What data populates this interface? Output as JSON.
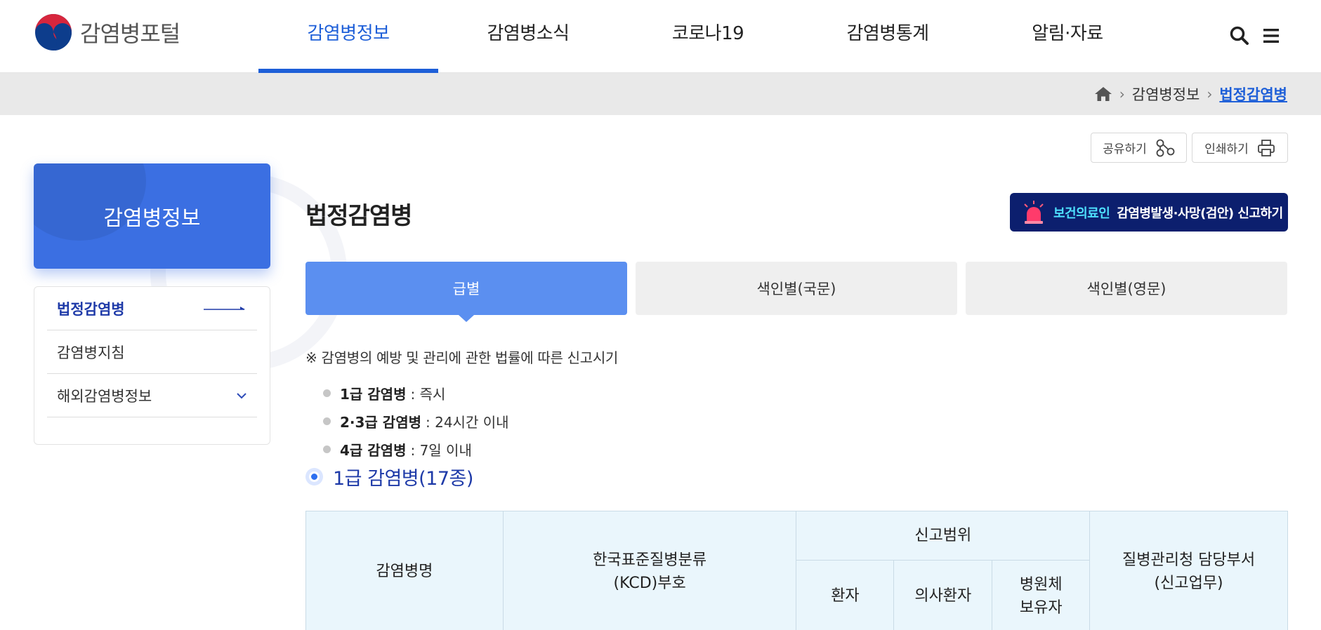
{
  "header": {
    "logo_text": "감염병포털",
    "nav": [
      "감염병정보",
      "감염병소식",
      "코로나19",
      "감염병통계",
      "알림·자료"
    ],
    "active_nav": "감염병정보",
    "icons": [
      "search-icon",
      "menu-icon"
    ]
  },
  "breadcrumb": {
    "icon": "home-icon",
    "items": [
      "감염병정보",
      "법정감염병"
    ]
  },
  "utility": {
    "share_label": "공유하기",
    "print_label": "인쇄하기"
  },
  "sidebar": {
    "title": "감염병정보",
    "items": [
      {
        "label": "법정감염병"
      },
      {
        "label": "감염병지침"
      },
      {
        "label": "해외감염병정보"
      }
    ]
  },
  "main": {
    "title": "법정감염병",
    "report_button": {
      "highlight": "보건의료인",
      "label": "감염병발생·사망(검안) 신고하기"
    },
    "tabs": [
      "급별",
      "색인별(국문)",
      "색인별(영문)"
    ],
    "active_tab": "급별",
    "notice": "※ 감염병의 예방 및 관리에 관한 법률에 따른 신고시기",
    "bullets": [
      {
        "term": "1급 감염병",
        "desc": ": 즉시"
      },
      {
        "term": "2·3급 감염병",
        "desc": ": 24시간 이내"
      },
      {
        "term": "4급 감염병",
        "desc": ": 7일 이내"
      }
    ],
    "section_title": "1급 감염병(17종)",
    "table": {
      "col_name": "감염병명",
      "col_kcd": [
        "한국표준질병분류",
        "(KCD)부호"
      ],
      "col_scope": "신고범위",
      "col_dept": [
        "질병관리청 담당부서",
        "(신고업무)"
      ],
      "sub_cols": [
        "환자",
        "의사환자",
        "병원체",
        "보유자"
      ]
    }
  },
  "colors": {
    "accent": "#1e5fd8",
    "sidebar_title_bg": "#3b6fe2",
    "report_bg": "#0c1f6e",
    "active_tab_bg": "#5b8ff0",
    "table_header_bg": "#eaf6fc"
  }
}
